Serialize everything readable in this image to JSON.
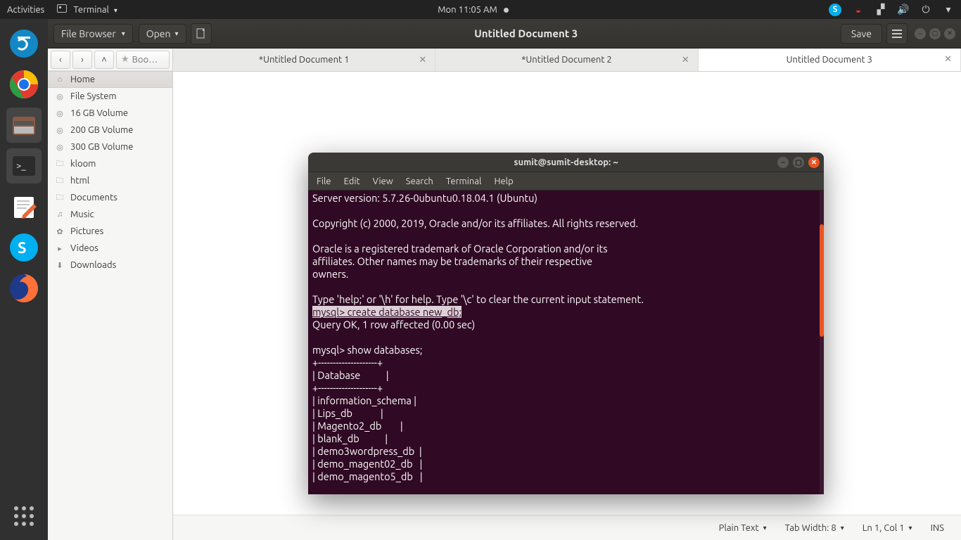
{
  "topbar": {
    "activities": "Activities",
    "app": "Terminal",
    "clock": "Mon 11:05 AM"
  },
  "headerbar": {
    "file_browser": "File Browser",
    "open": "Open",
    "title": "Untitled Document 3",
    "save": "Save"
  },
  "sidebar": {
    "bookmark": "Boo…",
    "items": [
      {
        "icon": "home",
        "label": "Home",
        "selected": true
      },
      {
        "icon": "disk",
        "label": "File System"
      },
      {
        "icon": "disk",
        "label": "16 GB Volume"
      },
      {
        "icon": "disk",
        "label": "200 GB Volume"
      },
      {
        "icon": "disk",
        "label": "300 GB Volume"
      },
      {
        "icon": "folder",
        "label": "kloom"
      },
      {
        "icon": "folder",
        "label": "html"
      },
      {
        "icon": "folder",
        "label": "Documents"
      },
      {
        "icon": "music",
        "label": "Music"
      },
      {
        "icon": "pic",
        "label": "Pictures"
      },
      {
        "icon": "video",
        "label": "Videos"
      },
      {
        "icon": "down",
        "label": "Downloads"
      }
    ]
  },
  "tabs": [
    {
      "label": "*Untitled Document 1",
      "active": false
    },
    {
      "label": "*Untitled Document 2",
      "active": false
    },
    {
      "label": "Untitled Document 3",
      "active": true
    }
  ],
  "statusbar": {
    "syntax": "Plain Text",
    "tabwidth": "Tab Width: 8",
    "position": "Ln 1, Col 1",
    "mode": "INS"
  },
  "terminal": {
    "title": "sumit@sumit-desktop: ~",
    "menu": [
      "File",
      "Edit",
      "View",
      "Search",
      "Terminal",
      "Help"
    ],
    "pre": "Server version: 5.7.26-0ubuntu0.18.04.1 (Ubuntu)\n\nCopyright (c) 2000, 2019, Oracle and/or its affiliates. All rights reserved.\n\nOracle is a registered trademark of Oracle Corporation and/or its\naffiliates. Other names may be trademarks of their respective\nowners.\n\nType 'help;' or '\\h' for help. Type '\\c' to clear the current input statement.\n",
    "selected": "mysql> create database new_db;",
    "post": "\nQuery OK, 1 row affected (0.00 sec)\n\nmysql> show databases;\n+--------------------+\n| Database           |\n+--------------------+\n| information_schema |\n| Lips_db            |\n| Magento2_db        |\n| blank_db           |\n| demo3wordpress_db  |\n| demo_magent02_db   |\n| demo_magento5_db   |"
  }
}
